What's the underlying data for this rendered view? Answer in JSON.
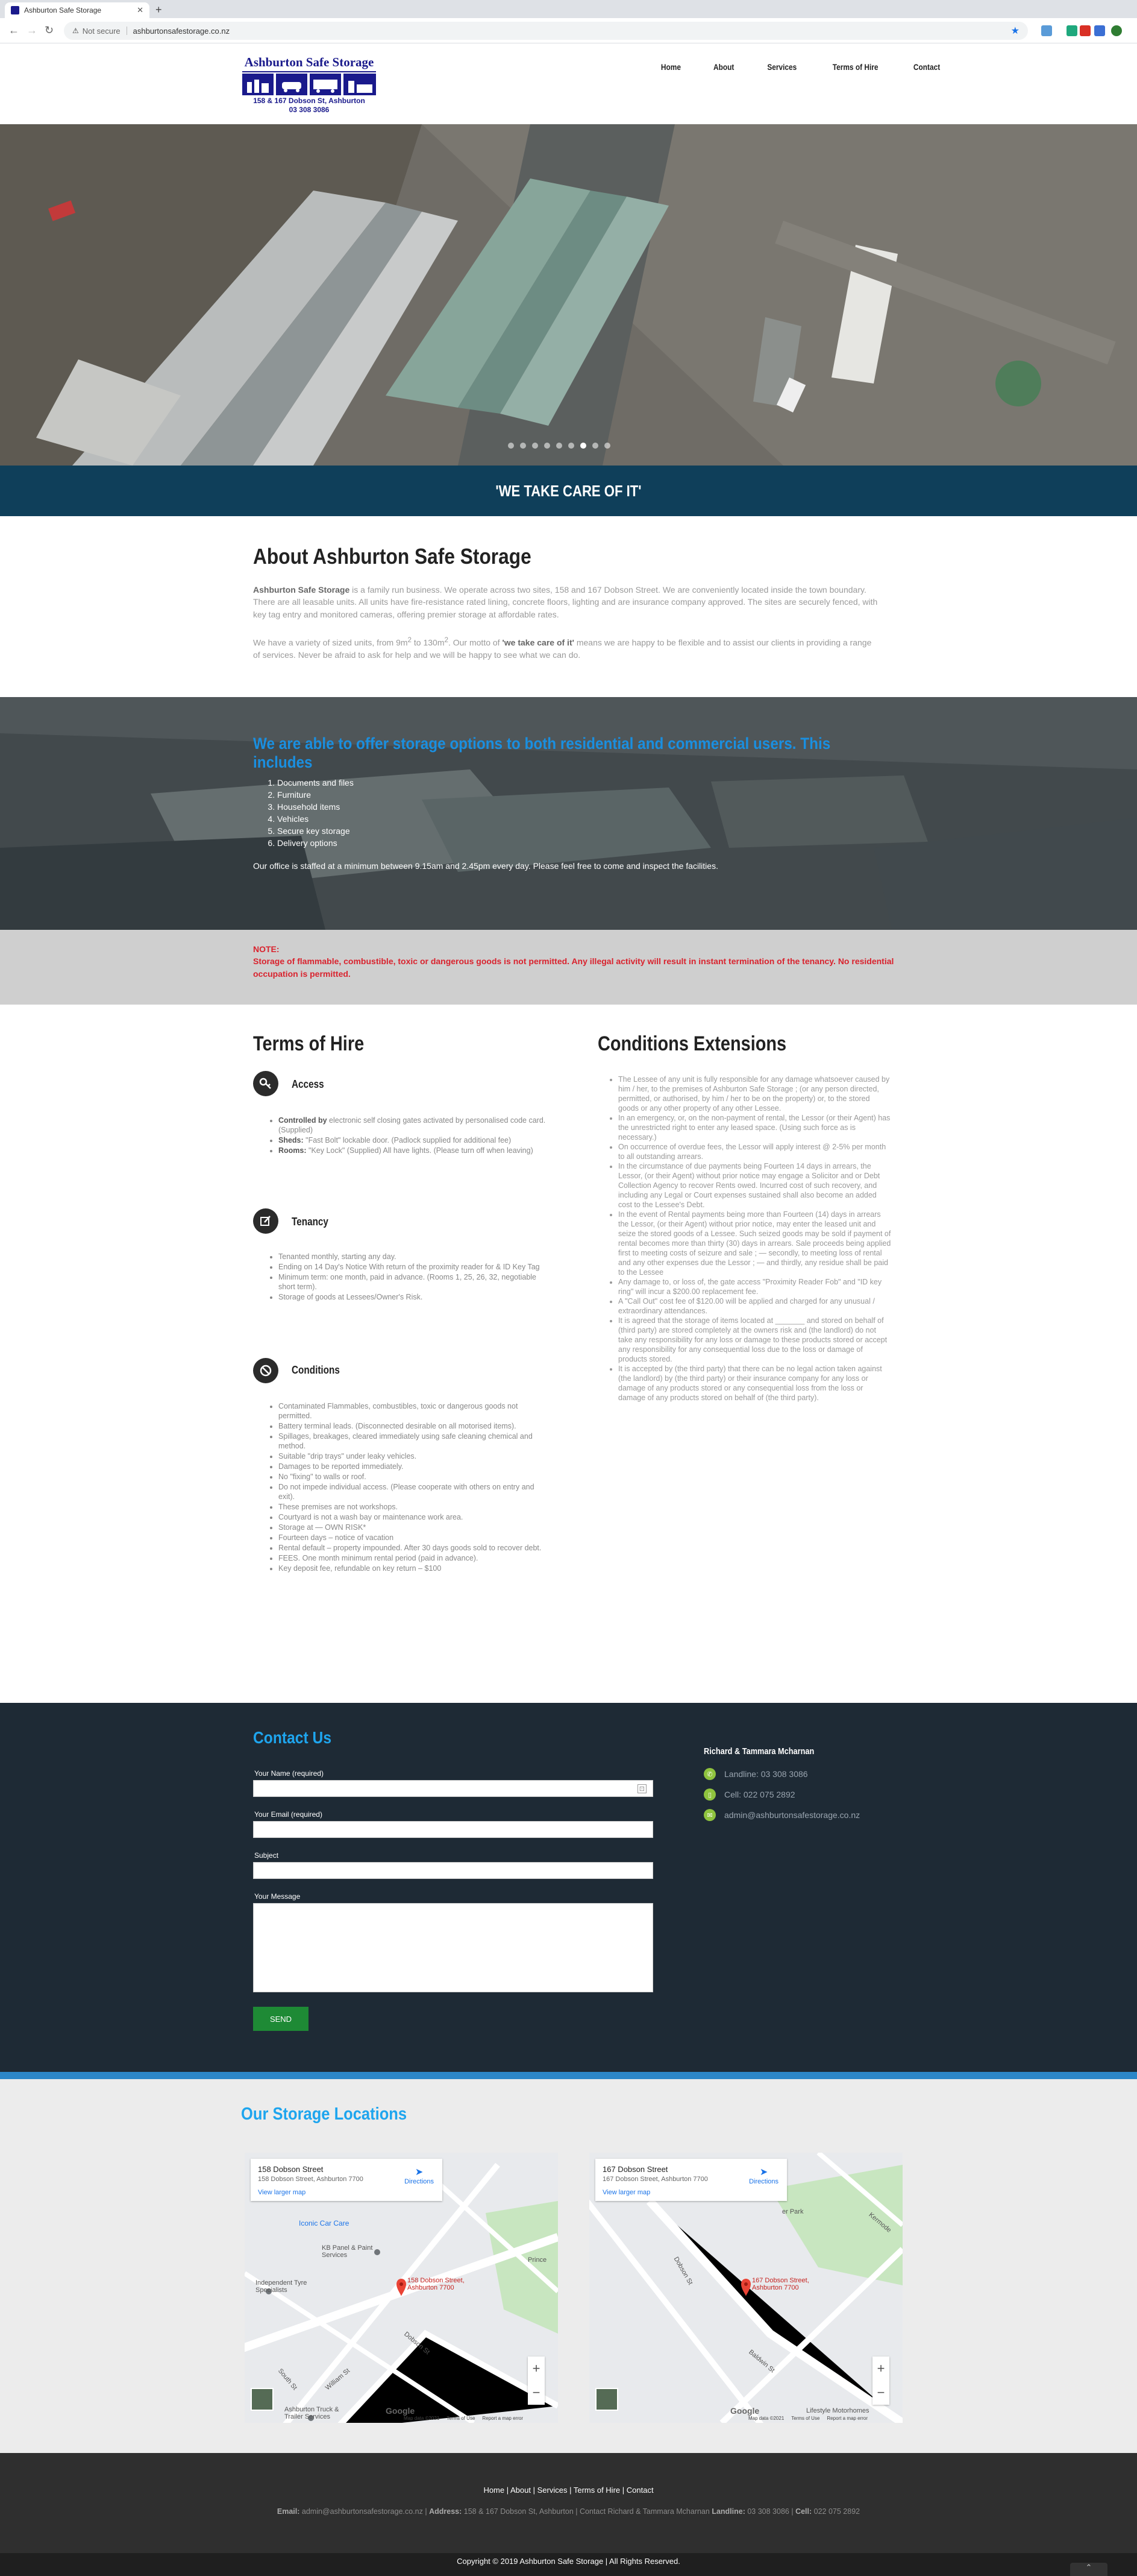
{
  "browser": {
    "tab_title": "Ashburton Safe Storage",
    "security": "Not secure",
    "url": "ashburtonsafestorage.co.nz"
  },
  "logo": {
    "name": "Ashburton Safe Storage",
    "address": "158 & 167 Dobson St, Ashburton",
    "phone": "03 308 3086"
  },
  "nav": [
    "Home",
    "About",
    "Services",
    "Terms of Hire",
    "Contact"
  ],
  "hero": {
    "slide_count": 9,
    "active_slide": 6
  },
  "tagline": "'WE TAKE CARE OF IT'",
  "about": {
    "title": "About Ashburton Safe Storage",
    "p1_strong": "Ashburton Safe Storage",
    "p1": " is a family run business.  We operate across two sites, 158 and 167 Dobson Street. We are conveniently located inside the town boundary.  There are all leasable units.  All units have fire-resistance rated lining, concrete floors, lighting and are insurance company approved.  The sites are securely fenced, with key tag entry and monitored cameras, offering premier storage at affordable rates.",
    "p2_a": "We have a variety of sized units, from 9m",
    "p2_b": " to 130m",
    "p2_c": ".  Our motto of ",
    "p2_motto": "'we take care of it'",
    "p2_d": " means we are happy to be flexible and to assist our clients in providing a range of services. Never be afraid to ask for help and we will be happy to see what we can do.",
    "sup": "2"
  },
  "offer": {
    "title": "We are able to offer storage options to both residential and commercial users.  This includes",
    "items": [
      "Documents and files",
      "Furniture",
      "Household items",
      "Vehicles",
      "Secure key storage",
      "Delivery options"
    ],
    "note": "Our office is staffed at a minimum between 9.15am and 2.45pm every day.  Please feel free to come and inspect the facilities."
  },
  "note": {
    "label": "NOTE:",
    "text": "Storage of flammable, combustible, toxic or dangerous goods is not permitted.  Any illegal activity will result in instant termination of the tenancy.  No residential occupation is permitted."
  },
  "terms": {
    "title": "Terms of Hire",
    "access": {
      "heading": "Access",
      "items": [
        {
          "b": "Controlled by",
          "t": " electronic self closing gates activated by personalised code card. (Supplied)"
        },
        {
          "b": "Sheds:",
          "t": " \"Fast Bolt\" lockable door. (Padlock supplied for additional fee)"
        },
        {
          "b": "Rooms:",
          "t": " \"Key Lock\" (Supplied) All have lights. (Please turn off when leaving)"
        }
      ]
    },
    "tenancy": {
      "heading": "Tenancy",
      "items": [
        "Tenanted monthly, starting any day.",
        "Ending on 14 Day's Notice With return of the proximity reader for & ID Key Tag",
        "Minimum term: one month, paid in advance. (Rooms 1, 25, 26, 32, negotiable short term).",
        "Storage of goods at Lessees/Owner's Risk."
      ]
    },
    "conditions": {
      "heading": "Conditions",
      "items": [
        "Contaminated Flammables, combustibles, toxic or dangerous goods not permitted.",
        "Battery terminal leads. (Disconnected desirable on all motorised items).",
        "Spillages, breakages, cleared immediately using safe cleaning chemical and method.",
        "Suitable \"drip trays\" under leaky vehicles.",
        "Damages to be reported immediately.",
        "No \"fixing\" to walls or roof.",
        "Do not impede individual access. (Please cooperate with others on entry and exit).",
        "These premises are not workshops.",
        "Courtyard is not a wash bay or maintenance work area.",
        "Storage at — OWN RISK*",
        "Fourteen days – notice of vacation",
        "Rental default – property impounded. After 30 days goods sold to recover debt.",
        "FEES. One month minimum rental period (paid in advance).",
        "Key deposit fee, refundable on key return – $100"
      ]
    }
  },
  "conditions_ext": {
    "title": "Conditions Extensions",
    "items": [
      "The Lessee of any unit is fully responsible for any damage whatsoever caused by him / her, to the premises of Ashburton Safe Storage ; (or any person directed, permitted, or authorised, by him / her to be on the property) or, to the stored goods or any other property of any other Lessee.",
      "In an emergency, or, on the non-payment of rental, the Lessor (or their Agent) has the unrestricted right to enter any leased space. (Using such force as is necessary.)",
      "On occurrence of overdue fees, the Lessor will apply interest @ 2-5% per month to all outstanding arrears.",
      "In the circumstance of due payments being Fourteen 14 days in arrears, the Lessor, (or their Agent) without prior notice may engage a Solicitor and or Debt Collection Agency to recover Rents owed. Incurred cost of such recovery, and including any Legal or Court expenses sustained shall also become an added cost to the Lessee's Debt.",
      "In the event of Rental payments being more than Fourteen (14) days in arrears the Lessor, (or their Agent) without prior notice, may enter the leased unit and seize the stored goods of a Lessee. Such seized goods may be sold if payment of rental becomes more than thirty (30) days in arrears. Sale proceeds being applied first to meeting costs of seizure and sale ; — secondly, to meeting loss of rental and any other expenses due the Lessor ; — and thirdly, any residue shall be paid to the Lessee",
      "Any damage to, or loss of, the gate access \"Proximity Reader Fob\" and \"ID key ring\" will incur a $200.00 replacement fee.",
      "A \"Call Out\" cost fee of $120.00 will be applied and charged for any unusual / extraordinary attendances.",
      "It is agreed that the storage of items located at _______ and stored on behalf of (third party) are stored completely at the owners risk and (the landlord) do not take any responsibility for any loss or damage to these products stored or accept any responsibility for any consequential loss due to the loss or damage of products stored.",
      "It is accepted by (the third party) that there can be no legal action taken against (the landlord) by (the third party) or their insurance company for any loss or damage of any products stored or any consequential loss from the loss or damage of any products stored on behalf of (the third party)."
    ]
  },
  "contact": {
    "title": "Contact Us",
    "fields": {
      "name": "Your Name (required)",
      "email": "Your Email (required)",
      "subject": "Subject",
      "message": "Your Message"
    },
    "send": "SEND",
    "owners": "Richard & Tammara Mcharnan",
    "landline": "Landline: 03 308 3086",
    "cell": "Cell: 022 075 2892",
    "email": "admin@ashburtonsafestorage.co.nz"
  },
  "storage": {
    "title": "Our Storage Locations",
    "maps": [
      {
        "title": "158 Dobson Street",
        "address": "158 Dobson Street, Ashburton 7700",
        "directions": "Directions",
        "larger": "View larger map",
        "pin": "158 Dobson Street, Ashburton 7700",
        "labels": [
          "Iconic Car Care",
          "KB Panel & Paint Services",
          "Independent Tyre Specialists",
          "Ashburton Truck & Trailer Services",
          "Prince",
          "Dobson St",
          "William St",
          "South St"
        ]
      },
      {
        "title": "167 Dobson Street",
        "address": "167 Dobson Street, Ashburton 7700",
        "directions": "Directions",
        "larger": "View larger map",
        "pin": "167 Dobson Street, Ashburton 7700",
        "labels": [
          "Lifestyle Motorhomes",
          "er Park",
          "Dobson St",
          "Baldwin St",
          "Kermode"
        ]
      }
    ],
    "map_footer": [
      "Map data ©2021",
      "Terms of Use",
      "Report a map error"
    ],
    "google": "Google"
  },
  "footer": {
    "nav": [
      "Home",
      "About",
      "Services",
      "Terms of Hire",
      "Contact"
    ],
    "info_email_label": "Email:",
    "info_email": " admin@ashburtonsafestorage.co.nz | ",
    "info_address_label": "Address:",
    "info_address": " 158 & 167 Dobson St, Ashburton | Contact Richard & Tammara Mcharnan ",
    "info_landline_label": "Landline:",
    "info_landline": " 03 308 3086 | ",
    "info_cell_label": "Cell:",
    "info_cell": " 022 075 2892",
    "copyright": "Copyright © 2019 Ashburton Safe Storage | All Rights Reserved."
  }
}
